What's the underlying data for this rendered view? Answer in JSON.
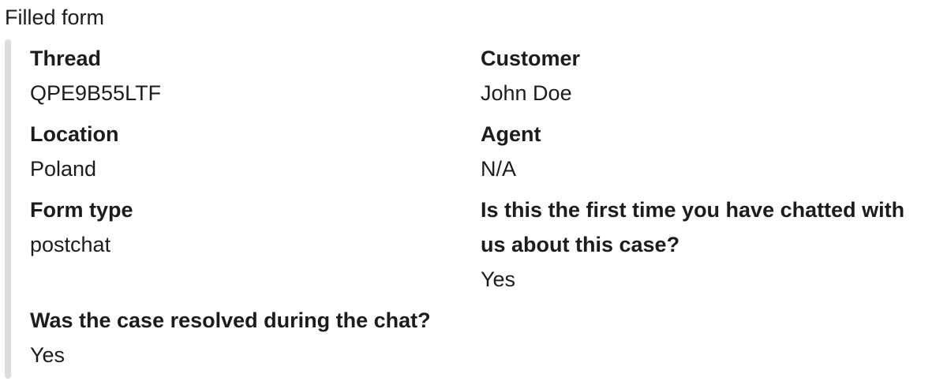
{
  "heading": "Filled form",
  "fields": {
    "thread": {
      "label": "Thread",
      "value": "QPE9B55LTF"
    },
    "customer": {
      "label": "Customer",
      "value": "John Doe"
    },
    "location": {
      "label": "Location",
      "value": "Poland"
    },
    "agent": {
      "label": "Agent",
      "value": "N/A"
    },
    "form_type": {
      "label": "Form type",
      "value": "postchat"
    },
    "first_time": {
      "label": "Is this the first time you have chatted with us about this case?",
      "value": "Yes"
    },
    "resolved": {
      "label": "Was the case resolved during the chat?",
      "value": "Yes"
    }
  },
  "colors": {
    "text": "#1d1c1d",
    "accent_bar": "#dddddd",
    "background": "#ffffff"
  }
}
